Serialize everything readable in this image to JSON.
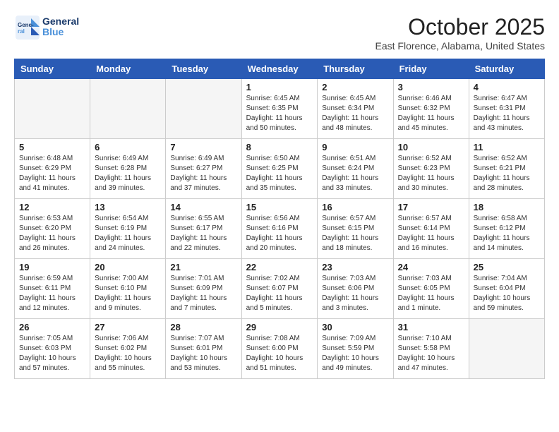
{
  "header": {
    "logo_general": "General",
    "logo_blue": "Blue",
    "title": "October 2025",
    "subtitle": "East Florence, Alabama, United States"
  },
  "weekdays": [
    "Sunday",
    "Monday",
    "Tuesday",
    "Wednesday",
    "Thursday",
    "Friday",
    "Saturday"
  ],
  "weeks": [
    [
      {
        "day": "",
        "info": ""
      },
      {
        "day": "",
        "info": ""
      },
      {
        "day": "",
        "info": ""
      },
      {
        "day": "1",
        "info": "Sunrise: 6:45 AM\nSunset: 6:35 PM\nDaylight: 11 hours\nand 50 minutes."
      },
      {
        "day": "2",
        "info": "Sunrise: 6:45 AM\nSunset: 6:34 PM\nDaylight: 11 hours\nand 48 minutes."
      },
      {
        "day": "3",
        "info": "Sunrise: 6:46 AM\nSunset: 6:32 PM\nDaylight: 11 hours\nand 45 minutes."
      },
      {
        "day": "4",
        "info": "Sunrise: 6:47 AM\nSunset: 6:31 PM\nDaylight: 11 hours\nand 43 minutes."
      }
    ],
    [
      {
        "day": "5",
        "info": "Sunrise: 6:48 AM\nSunset: 6:29 PM\nDaylight: 11 hours\nand 41 minutes."
      },
      {
        "day": "6",
        "info": "Sunrise: 6:49 AM\nSunset: 6:28 PM\nDaylight: 11 hours\nand 39 minutes."
      },
      {
        "day": "7",
        "info": "Sunrise: 6:49 AM\nSunset: 6:27 PM\nDaylight: 11 hours\nand 37 minutes."
      },
      {
        "day": "8",
        "info": "Sunrise: 6:50 AM\nSunset: 6:25 PM\nDaylight: 11 hours\nand 35 minutes."
      },
      {
        "day": "9",
        "info": "Sunrise: 6:51 AM\nSunset: 6:24 PM\nDaylight: 11 hours\nand 33 minutes."
      },
      {
        "day": "10",
        "info": "Sunrise: 6:52 AM\nSunset: 6:23 PM\nDaylight: 11 hours\nand 30 minutes."
      },
      {
        "day": "11",
        "info": "Sunrise: 6:52 AM\nSunset: 6:21 PM\nDaylight: 11 hours\nand 28 minutes."
      }
    ],
    [
      {
        "day": "12",
        "info": "Sunrise: 6:53 AM\nSunset: 6:20 PM\nDaylight: 11 hours\nand 26 minutes."
      },
      {
        "day": "13",
        "info": "Sunrise: 6:54 AM\nSunset: 6:19 PM\nDaylight: 11 hours\nand 24 minutes."
      },
      {
        "day": "14",
        "info": "Sunrise: 6:55 AM\nSunset: 6:17 PM\nDaylight: 11 hours\nand 22 minutes."
      },
      {
        "day": "15",
        "info": "Sunrise: 6:56 AM\nSunset: 6:16 PM\nDaylight: 11 hours\nand 20 minutes."
      },
      {
        "day": "16",
        "info": "Sunrise: 6:57 AM\nSunset: 6:15 PM\nDaylight: 11 hours\nand 18 minutes."
      },
      {
        "day": "17",
        "info": "Sunrise: 6:57 AM\nSunset: 6:14 PM\nDaylight: 11 hours\nand 16 minutes."
      },
      {
        "day": "18",
        "info": "Sunrise: 6:58 AM\nSunset: 6:12 PM\nDaylight: 11 hours\nand 14 minutes."
      }
    ],
    [
      {
        "day": "19",
        "info": "Sunrise: 6:59 AM\nSunset: 6:11 PM\nDaylight: 11 hours\nand 12 minutes."
      },
      {
        "day": "20",
        "info": "Sunrise: 7:00 AM\nSunset: 6:10 PM\nDaylight: 11 hours\nand 9 minutes."
      },
      {
        "day": "21",
        "info": "Sunrise: 7:01 AM\nSunset: 6:09 PM\nDaylight: 11 hours\nand 7 minutes."
      },
      {
        "day": "22",
        "info": "Sunrise: 7:02 AM\nSunset: 6:07 PM\nDaylight: 11 hours\nand 5 minutes."
      },
      {
        "day": "23",
        "info": "Sunrise: 7:03 AM\nSunset: 6:06 PM\nDaylight: 11 hours\nand 3 minutes."
      },
      {
        "day": "24",
        "info": "Sunrise: 7:03 AM\nSunset: 6:05 PM\nDaylight: 11 hours\nand 1 minute."
      },
      {
        "day": "25",
        "info": "Sunrise: 7:04 AM\nSunset: 6:04 PM\nDaylight: 10 hours\nand 59 minutes."
      }
    ],
    [
      {
        "day": "26",
        "info": "Sunrise: 7:05 AM\nSunset: 6:03 PM\nDaylight: 10 hours\nand 57 minutes."
      },
      {
        "day": "27",
        "info": "Sunrise: 7:06 AM\nSunset: 6:02 PM\nDaylight: 10 hours\nand 55 minutes."
      },
      {
        "day": "28",
        "info": "Sunrise: 7:07 AM\nSunset: 6:01 PM\nDaylight: 10 hours\nand 53 minutes."
      },
      {
        "day": "29",
        "info": "Sunrise: 7:08 AM\nSunset: 6:00 PM\nDaylight: 10 hours\nand 51 minutes."
      },
      {
        "day": "30",
        "info": "Sunrise: 7:09 AM\nSunset: 5:59 PM\nDaylight: 10 hours\nand 49 minutes."
      },
      {
        "day": "31",
        "info": "Sunrise: 7:10 AM\nSunset: 5:58 PM\nDaylight: 10 hours\nand 47 minutes."
      },
      {
        "day": "",
        "info": ""
      }
    ]
  ]
}
